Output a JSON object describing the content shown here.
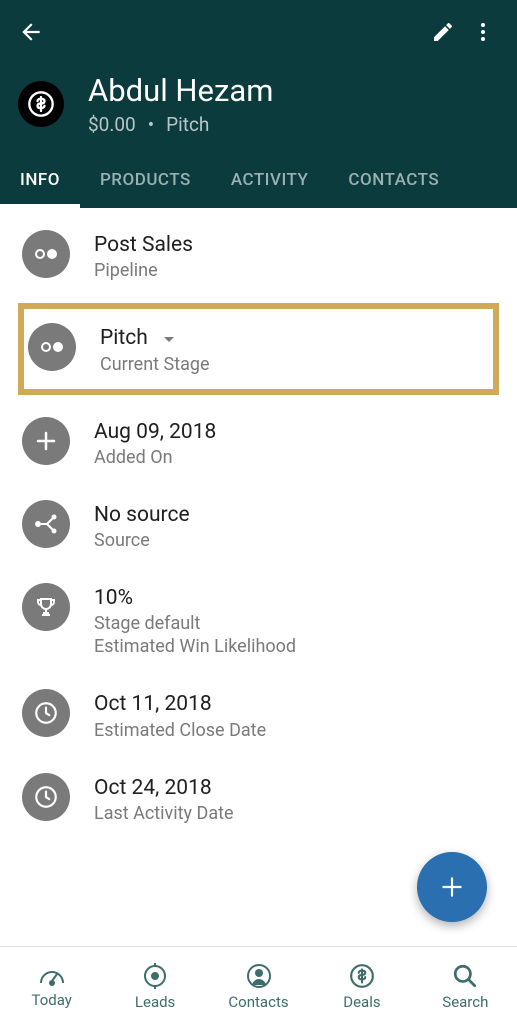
{
  "header": {
    "title": "Abdul Hezam",
    "amount": "$0.00",
    "stage": "Pitch"
  },
  "tabs": [
    {
      "label": "INFO",
      "active": true
    },
    {
      "label": "PRODUCTS",
      "active": false
    },
    {
      "label": "ACTIVITY",
      "active": false
    },
    {
      "label": "CONTACTS",
      "active": false
    }
  ],
  "info_rows": [
    {
      "icon": "pipeline",
      "value": "Post Sales",
      "label": "Pipeline"
    },
    {
      "icon": "pipeline",
      "value": "Pitch",
      "label": "Current Stage",
      "dropdown": true,
      "highlighted": true
    },
    {
      "icon": "plus",
      "value": "Aug 09, 2018",
      "label": "Added On"
    },
    {
      "icon": "source",
      "value": "No source",
      "label": "Source"
    },
    {
      "icon": "trophy",
      "value": "10%",
      "label": "Stage default",
      "sub": "Estimated Win Likelihood"
    },
    {
      "icon": "clock",
      "value": "Oct 11, 2018",
      "label": "Estimated Close Date"
    },
    {
      "icon": "clock",
      "value": "Oct 24, 2018",
      "label": "Last Activity Date"
    }
  ],
  "bottomnav": [
    {
      "label": "Today",
      "icon": "today"
    },
    {
      "label": "Leads",
      "icon": "leads"
    },
    {
      "label": "Contacts",
      "icon": "contacts"
    },
    {
      "label": "Deals",
      "icon": "deals"
    },
    {
      "label": "Search",
      "icon": "search"
    }
  ]
}
